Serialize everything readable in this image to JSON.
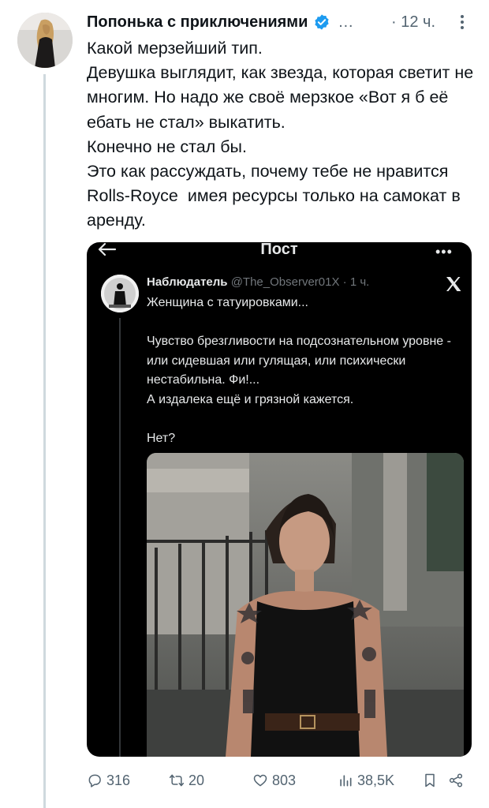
{
  "tweet": {
    "author_name": "Попонька с приключениями",
    "name_more": "…",
    "time": "· 12 ч.",
    "text": "Какой мерзейший тип.\nДевушка выглядит, как звезда, которая светит не многим. Но надо же своё мерзкое «Вот я б её ебать не стал» выкатить.\nКонечно не стал бы.\nЭто как рассуждать, почему тебе не нравится Rolls-Royce  имея ресурсы только на самокат в аренду.",
    "verified_color": "#1d9bf0"
  },
  "embed": {
    "header_title": "Пост",
    "more": "•••",
    "author_name": "Наблюдатель",
    "author_handle": "@The_Observer01X",
    "time": "· 1 ч.",
    "text": "Женщина с татуировками...\n\nЧувство брезгливости на подсознательном уровне - или сидевшая или гулящая, или психически нестабильна. Фи!...\nА издалека ещё и грязной кажется.\n\nНет?"
  },
  "actions": {
    "replies": "316",
    "reposts": "20",
    "likes": "803",
    "views": "38,5K"
  },
  "icons": {
    "verified": "verified-badge-icon",
    "more": "more-vertical-icon",
    "back": "back-arrow-icon",
    "x_logo": "x-logo-icon",
    "reply": "reply-icon",
    "repost": "repost-icon",
    "like": "heart-icon",
    "views": "views-icon",
    "bookmark": "bookmark-icon",
    "share": "share-icon"
  }
}
